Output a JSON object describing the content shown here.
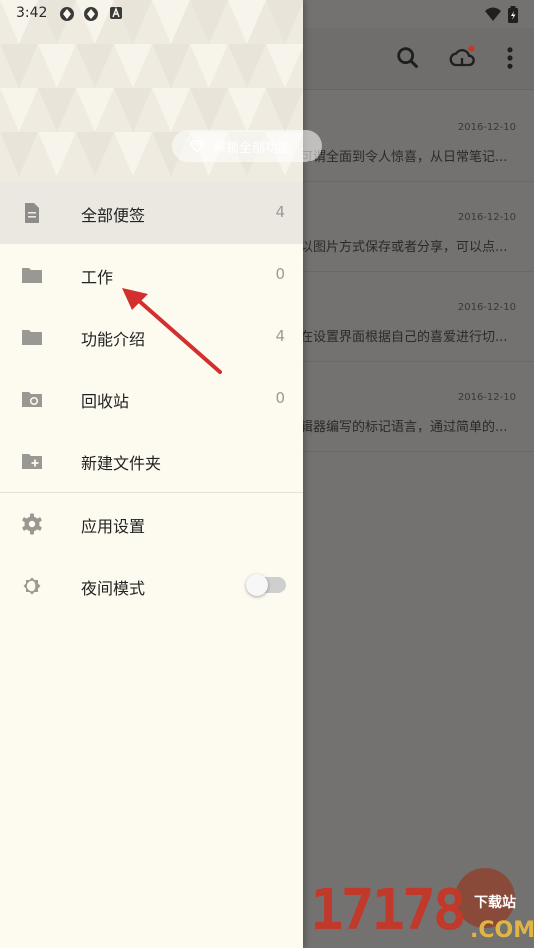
{
  "status_bar": {
    "time": "3:42"
  },
  "background_notes": [
    {
      "date": "2016-12-10",
      "snippet": "可谓全面到令人惊喜，从日常笔记..."
    },
    {
      "date": "2016-12-10",
      "snippet": "以图片方式保存或者分享，可以点..."
    },
    {
      "date": "2016-12-10",
      "snippet": "在设置界面根据自己的喜爱进行切..."
    },
    {
      "date": "2016-12-10",
      "snippet": "辑器编写的标记语言，通过简单的..."
    }
  ],
  "drawer": {
    "unlock_label": "解锁全部功能",
    "items": [
      {
        "icon": "note-icon",
        "label": "全部便签",
        "count": "4"
      },
      {
        "icon": "folder-icon",
        "label": "工作",
        "count": "0"
      },
      {
        "icon": "folder-icon",
        "label": "功能介绍",
        "count": "4"
      },
      {
        "icon": "recycle-folder-icon",
        "label": "回收站",
        "count": "0"
      },
      {
        "icon": "new-folder-icon",
        "label": "新建文件夹"
      }
    ],
    "settings": {
      "icon": "gear-icon",
      "label": "应用设置"
    },
    "night_mode": {
      "icon": "night-mode-icon",
      "label": "夜间模式",
      "enabled": false
    }
  },
  "watermark": {
    "number": "17178",
    "site": "下载站",
    "domain": ".COM"
  },
  "colors": {
    "drawer_bg": "#fdfbf0",
    "active_item": "#eae8e0",
    "annotation_arrow": "#d32f2f"
  }
}
